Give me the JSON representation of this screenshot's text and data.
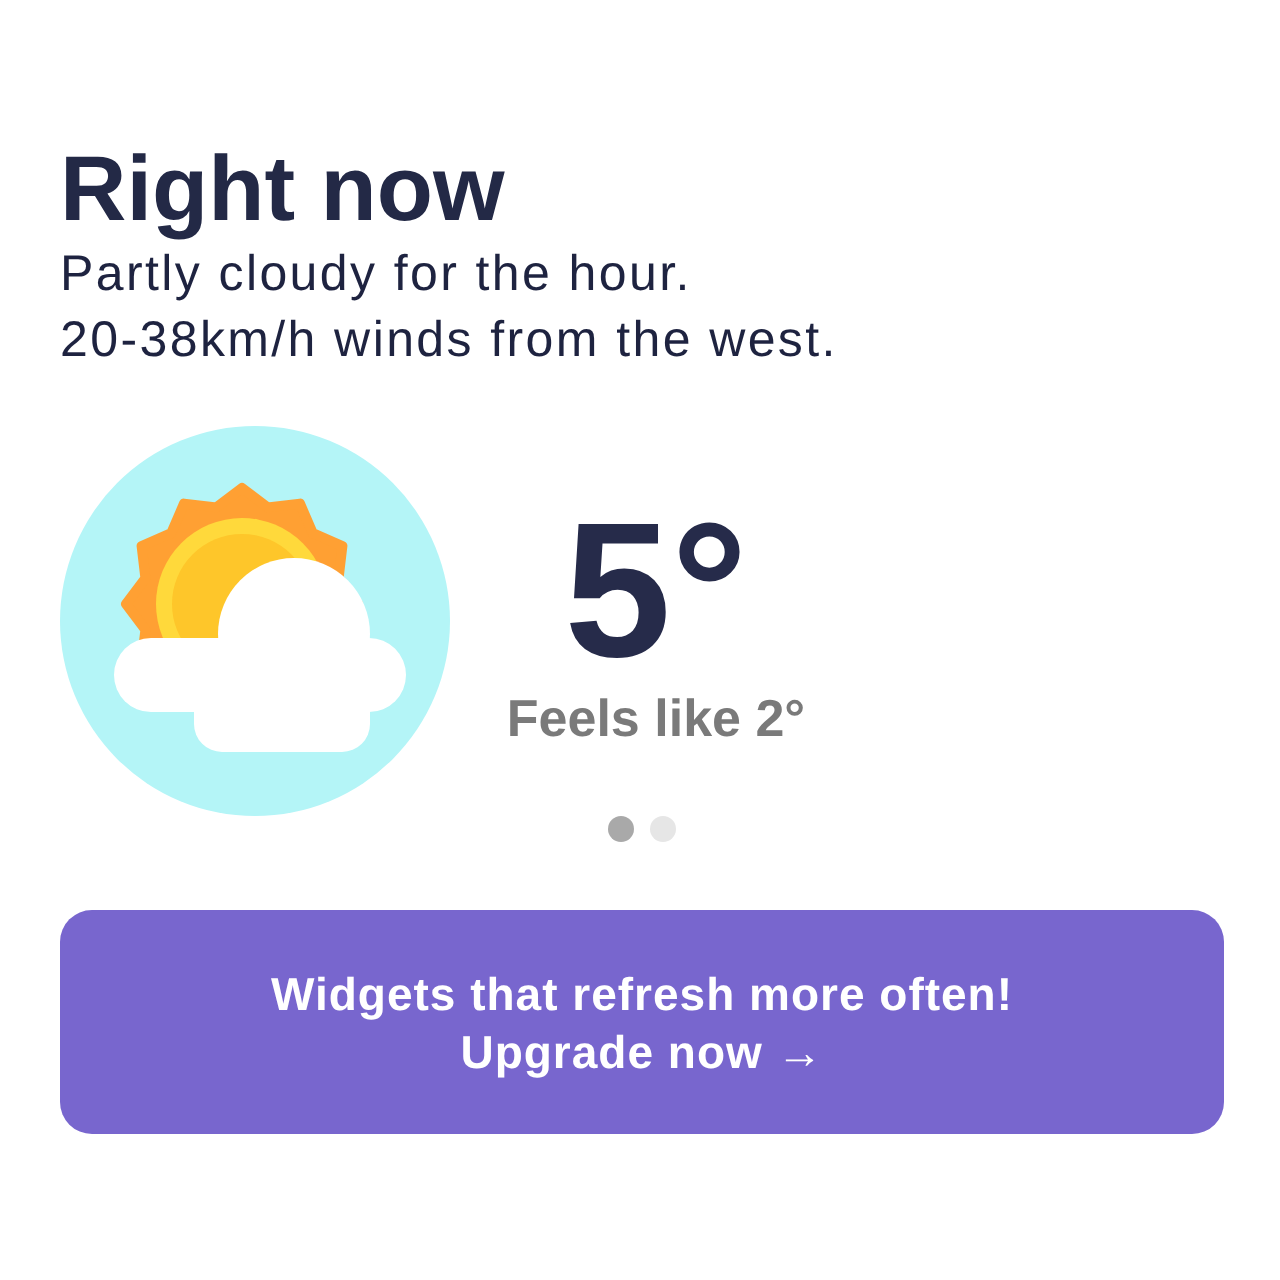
{
  "header": {
    "title": "Right now",
    "description": [
      "Partly cloudy for the hour.",
      "20-38km/h winds from the west."
    ]
  },
  "current": {
    "temperature": "5°",
    "feels_like": "Feels like 2°"
  },
  "pager": [
    {
      "selected": true
    },
    {
      "selected": false
    }
  ],
  "upgrade_button": {
    "lines": [
      "Widgets that refresh more often!",
      "Upgrade now →"
    ]
  }
}
